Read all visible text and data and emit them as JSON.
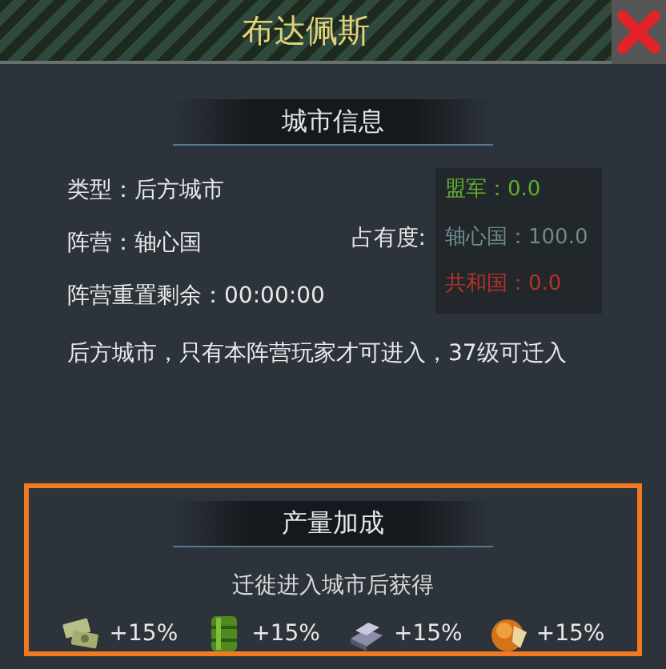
{
  "window": {
    "title": "布达佩斯"
  },
  "city_info": {
    "heading": "城市信息",
    "fields": [
      {
        "label": "类型：后方城市"
      },
      {
        "label": "阵营：轴心国"
      },
      {
        "label": "阵营重置剩余：00:00:00"
      }
    ],
    "occupancy_label": "占有度:",
    "occupancy": [
      {
        "text": "盟军：0.0",
        "color": "#5fae2e"
      },
      {
        "text": "轴心国：100.0",
        "color": "#6f8a8a"
      },
      {
        "text": "共和国：0.0",
        "color": "#b8322a"
      }
    ],
    "description": "后方城市，只有本阵营玩家才可进入，37级可迁入"
  },
  "production_bonus": {
    "heading": "产量加成",
    "highlighted": true,
    "subtitle": "迁徙进入城市后获得",
    "resources": [
      {
        "kind": "money",
        "value": "+15%"
      },
      {
        "kind": "oil",
        "value": "+15%"
      },
      {
        "kind": "steel",
        "value": "+15%"
      },
      {
        "kind": "rubber",
        "value": "+15%"
      }
    ]
  }
}
